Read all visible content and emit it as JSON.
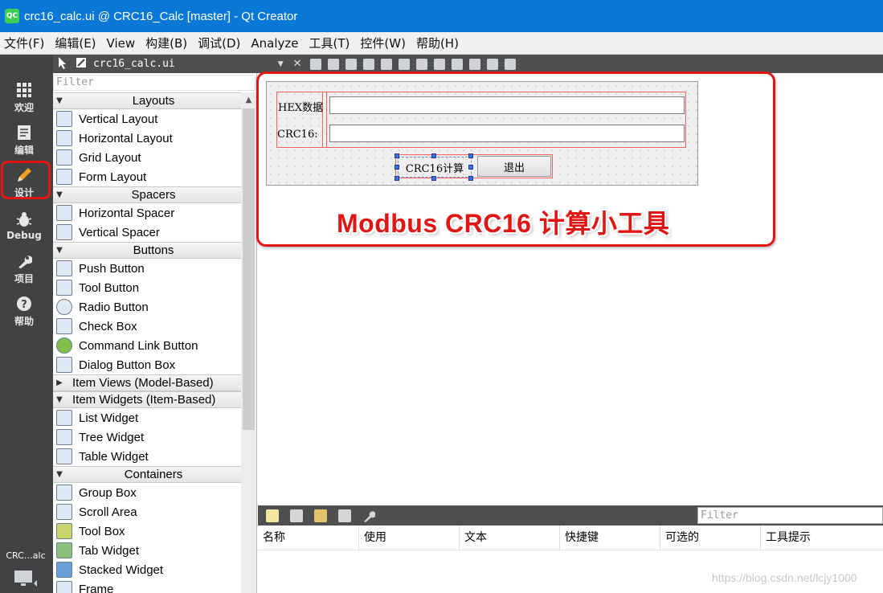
{
  "window": {
    "icon_label": "QC",
    "title": "crc16_calc.ui @ CRC16_Calc [master] - Qt Creator"
  },
  "menubar": [
    "文件(F)",
    "编辑(E)",
    "View",
    "构建(B)",
    "调试(D)",
    "Analyze",
    "工具(T)",
    "控件(W)",
    "帮助(H)"
  ],
  "modes": [
    {
      "label": "欢迎",
      "icon": "grid-icon"
    },
    {
      "label": "编辑",
      "icon": "document-icon"
    },
    {
      "label": "设计",
      "icon": "pencil-icon",
      "active": true
    },
    {
      "label": "Debug",
      "icon": "bug-icon"
    },
    {
      "label": "项目",
      "icon": "wrench-icon"
    },
    {
      "label": "帮助",
      "icon": "help-icon"
    }
  ],
  "modebar_bottom": {
    "project_label": "CRC…alc"
  },
  "toolbar": {
    "document": "crc16_calc.ui"
  },
  "widgetbox": {
    "filter_placeholder": "Filter",
    "categories": [
      {
        "label": "Layouts",
        "expanded": true,
        "items": [
          "Vertical Layout",
          "Horizontal Layout",
          "Grid Layout",
          "Form Layout"
        ]
      },
      {
        "label": "Spacers",
        "expanded": true,
        "items": [
          "Horizontal Spacer",
          "Vertical Spacer"
        ]
      },
      {
        "label": "Buttons",
        "expanded": true,
        "items": [
          "Push Button",
          "Tool Button",
          "Radio Button",
          "Check Box",
          "Command Link Button",
          "Dialog Button Box"
        ]
      },
      {
        "label": "Item Views (Model-Based)",
        "expanded": false,
        "items": []
      },
      {
        "label": "Item Widgets (Item-Based)",
        "expanded": true,
        "items": [
          "List Widget",
          "Tree Widget",
          "Table Widget"
        ]
      },
      {
        "label": "Containers",
        "expanded": true,
        "items": [
          "Group Box",
          "Scroll Area",
          "Tool Box",
          "Tab Widget",
          "Stacked Widget",
          "Frame"
        ]
      }
    ]
  },
  "form": {
    "hex_label": "HEX数据",
    "crc_label": "CRC16:",
    "hex_value": "",
    "crc_value": "",
    "calc_button": "CRC16计算",
    "exit_button": "退出"
  },
  "annotation": {
    "text": "Modbus CRC16 计算小工具",
    "color": "#e21515"
  },
  "action_editor": {
    "filter_placeholder": "Filter",
    "columns": [
      "名称",
      "使用",
      "文本",
      "快捷键",
      "可选的",
      "工具提示"
    ]
  },
  "watermark": "https://blog.csdn.net/lcjy1000",
  "colors": {
    "titlebar": "#0a78d7",
    "modebar": "#404244",
    "accent_red": "#e21515"
  }
}
